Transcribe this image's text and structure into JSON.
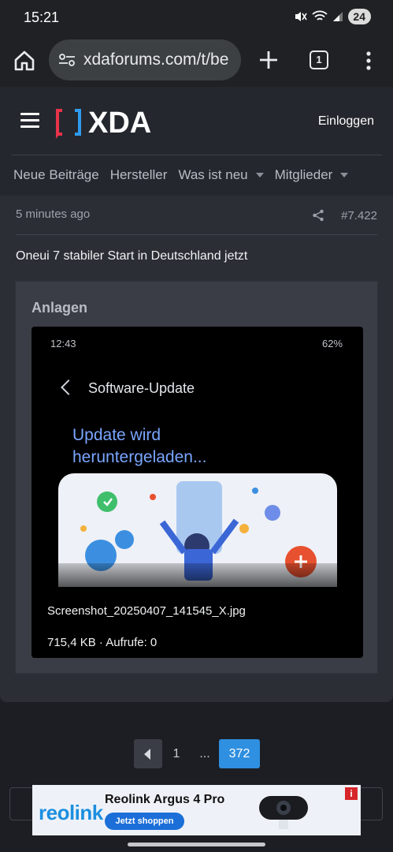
{
  "status_bar": {
    "time": "15:21",
    "battery": "24"
  },
  "browser": {
    "url": "xdaforums.com/t/be",
    "tab_count": "1"
  },
  "site": {
    "logo_text": "XDA",
    "login_label": "Einloggen",
    "nav": [
      {
        "label": "Neue Beiträge",
        "has_dropdown": false
      },
      {
        "label": "Hersteller",
        "has_dropdown": false
      },
      {
        "label": "Was ist neu",
        "has_dropdown": true
      },
      {
        "label": "Mitglieder",
        "has_dropdown": true
      }
    ]
  },
  "post": {
    "time": "5 minutes ago",
    "number": "#7.422",
    "body": "Oneui 7 stabiler Start in Deutschland jetzt",
    "attachments_title": "Anlagen",
    "attachment": {
      "thumbnail": {
        "status_time": "12:43",
        "status_battery": "62%",
        "screen_title": "Software-Update",
        "heading_line1": "Update wird",
        "heading_line2": "heruntergeladen..."
      },
      "filename": "Screenshot_20250407_141545_X.jpg",
      "meta": "715,4 KB · Aufrufe: 0"
    }
  },
  "pagination": {
    "first": "1",
    "ellipsis": "...",
    "current": "372"
  },
  "ad": {
    "brand": "reolink",
    "title": "Reolink Argus 4 Pro",
    "cta": "Jetzt shoppen",
    "badge": "i"
  },
  "colors": {
    "accent": "#2f8fe0",
    "logo_red": "#e8334a",
    "logo_blue": "#2f9bef",
    "header_bg": "#25272e",
    "post_bg": "#2b2e35"
  }
}
